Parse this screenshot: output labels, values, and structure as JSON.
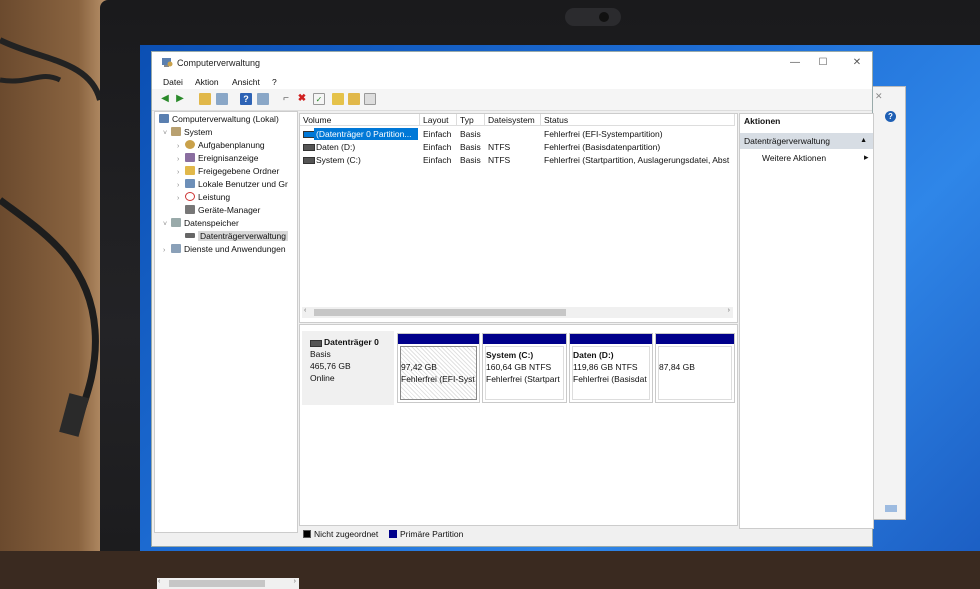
{
  "window": {
    "title": "Computerverwaltung",
    "controls": {
      "minimize": "—",
      "maximize": "☐",
      "close": "✕"
    }
  },
  "menu": {
    "items": [
      "Datei",
      "Aktion",
      "Ansicht",
      "?"
    ]
  },
  "toolbar": {
    "icons": [
      "back-arrow-icon",
      "forward-arrow-icon",
      "folder-up-icon",
      "properties-icon",
      "help-icon",
      "view-icon",
      "connect-icon",
      "delete-icon",
      "check-icon",
      "export-icon",
      "find-icon",
      "console-icon"
    ]
  },
  "tree": {
    "root": "Computerverwaltung (Lokal)",
    "items": [
      {
        "label": "System",
        "level": 1,
        "expanded": true
      },
      {
        "label": "Aufgabenplanung",
        "level": 2
      },
      {
        "label": "Ereignisanzeige",
        "level": 2
      },
      {
        "label": "Freigegebene Ordner",
        "level": 2
      },
      {
        "label": "Lokale Benutzer und Gr",
        "level": 2
      },
      {
        "label": "Leistung",
        "level": 2
      },
      {
        "label": "Geräte-Manager",
        "level": 2
      },
      {
        "label": "Datenspeicher",
        "level": 1,
        "expanded": true
      },
      {
        "label": "Datenträgerverwaltung",
        "level": 2,
        "selected": true
      },
      {
        "label": "Dienste und Anwendungen",
        "level": 1
      }
    ]
  },
  "volumes": {
    "columns": [
      "Volume",
      "Layout",
      "Typ",
      "Dateisystem",
      "Status"
    ],
    "rows": [
      {
        "volume": "(Datenträger 0 Partition...",
        "layout": "Einfach",
        "typ": "Basis",
        "fs": "",
        "status": "Fehlerfrei (EFI-Systempartition)",
        "selected": true
      },
      {
        "volume": "Daten (D:)",
        "layout": "Einfach",
        "typ": "Basis",
        "fs": "NTFS",
        "status": "Fehlerfrei (Basisdatenpartition)"
      },
      {
        "volume": "System (C:)",
        "layout": "Einfach",
        "typ": "Basis",
        "fs": "NTFS",
        "status": "Fehlerfrei (Startpartition, Auslagerungsdatei, Abst"
      }
    ]
  },
  "disk": {
    "name": "Datenträger 0",
    "type": "Basis",
    "size": "465,76 GB",
    "state": "Online",
    "partitions": [
      {
        "title": "",
        "size": "97,42 GB",
        "status": "Fehlerfrei (EFI-Syst",
        "hatched": true
      },
      {
        "title": "System  (C:)",
        "size": "160,64 GB NTFS",
        "status": "Fehlerfrei (Startpart"
      },
      {
        "title": "Daten  (D:)",
        "size": "119,86 GB NTFS",
        "status": "Fehlerfrei (Basisdat"
      },
      {
        "title": "",
        "size": "87,84 GB",
        "status": ""
      }
    ]
  },
  "legend": {
    "unallocated": "Nicht zugeordnet",
    "primary": "Primäre Partition",
    "unallocated_color": "#000000",
    "primary_color": "#00008b"
  },
  "actions": {
    "header": "Aktionen",
    "section": "Datenträgerverwaltung",
    "more": "Weitere Aktionen"
  }
}
